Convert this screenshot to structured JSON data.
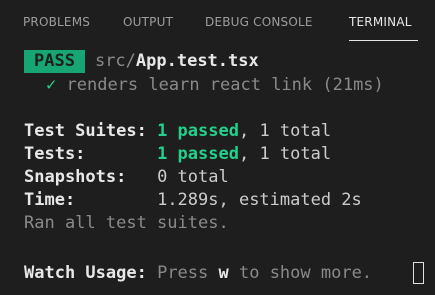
{
  "tabs": [
    {
      "label": "PROBLEMS",
      "active": false
    },
    {
      "label": "OUTPUT",
      "active": false
    },
    {
      "label": "DEBUG CONSOLE",
      "active": false
    },
    {
      "label": "TERMINAL",
      "active": true
    }
  ],
  "terminal": {
    "pass_badge": "PASS",
    "file_dir": "src/",
    "file_name": "App.test.tsx",
    "check_mark": "✓",
    "test_name": "renders learn react link (21ms)",
    "suites_label": "Test Suites:",
    "suites_passed": "1 passed",
    "suites_total": ", 1 total",
    "tests_label": "Tests:",
    "tests_passed": "1 passed",
    "tests_total": ", 1 total",
    "snapshots_label": "Snapshots:",
    "snapshots_value": "0 total",
    "time_label": "Time:",
    "time_value": "1.289s, estimated 2s",
    "ran_all": "Ran all test suites.",
    "watch_label": "Watch Usage:",
    "watch_press": "Press ",
    "watch_key": "w",
    "watch_rest": " to show more."
  },
  "colors": {
    "background": "#1e1e1e",
    "pass_badge": "#17a673",
    "passed_text": "#23d18b",
    "dim_text": "#8a8a8a"
  }
}
